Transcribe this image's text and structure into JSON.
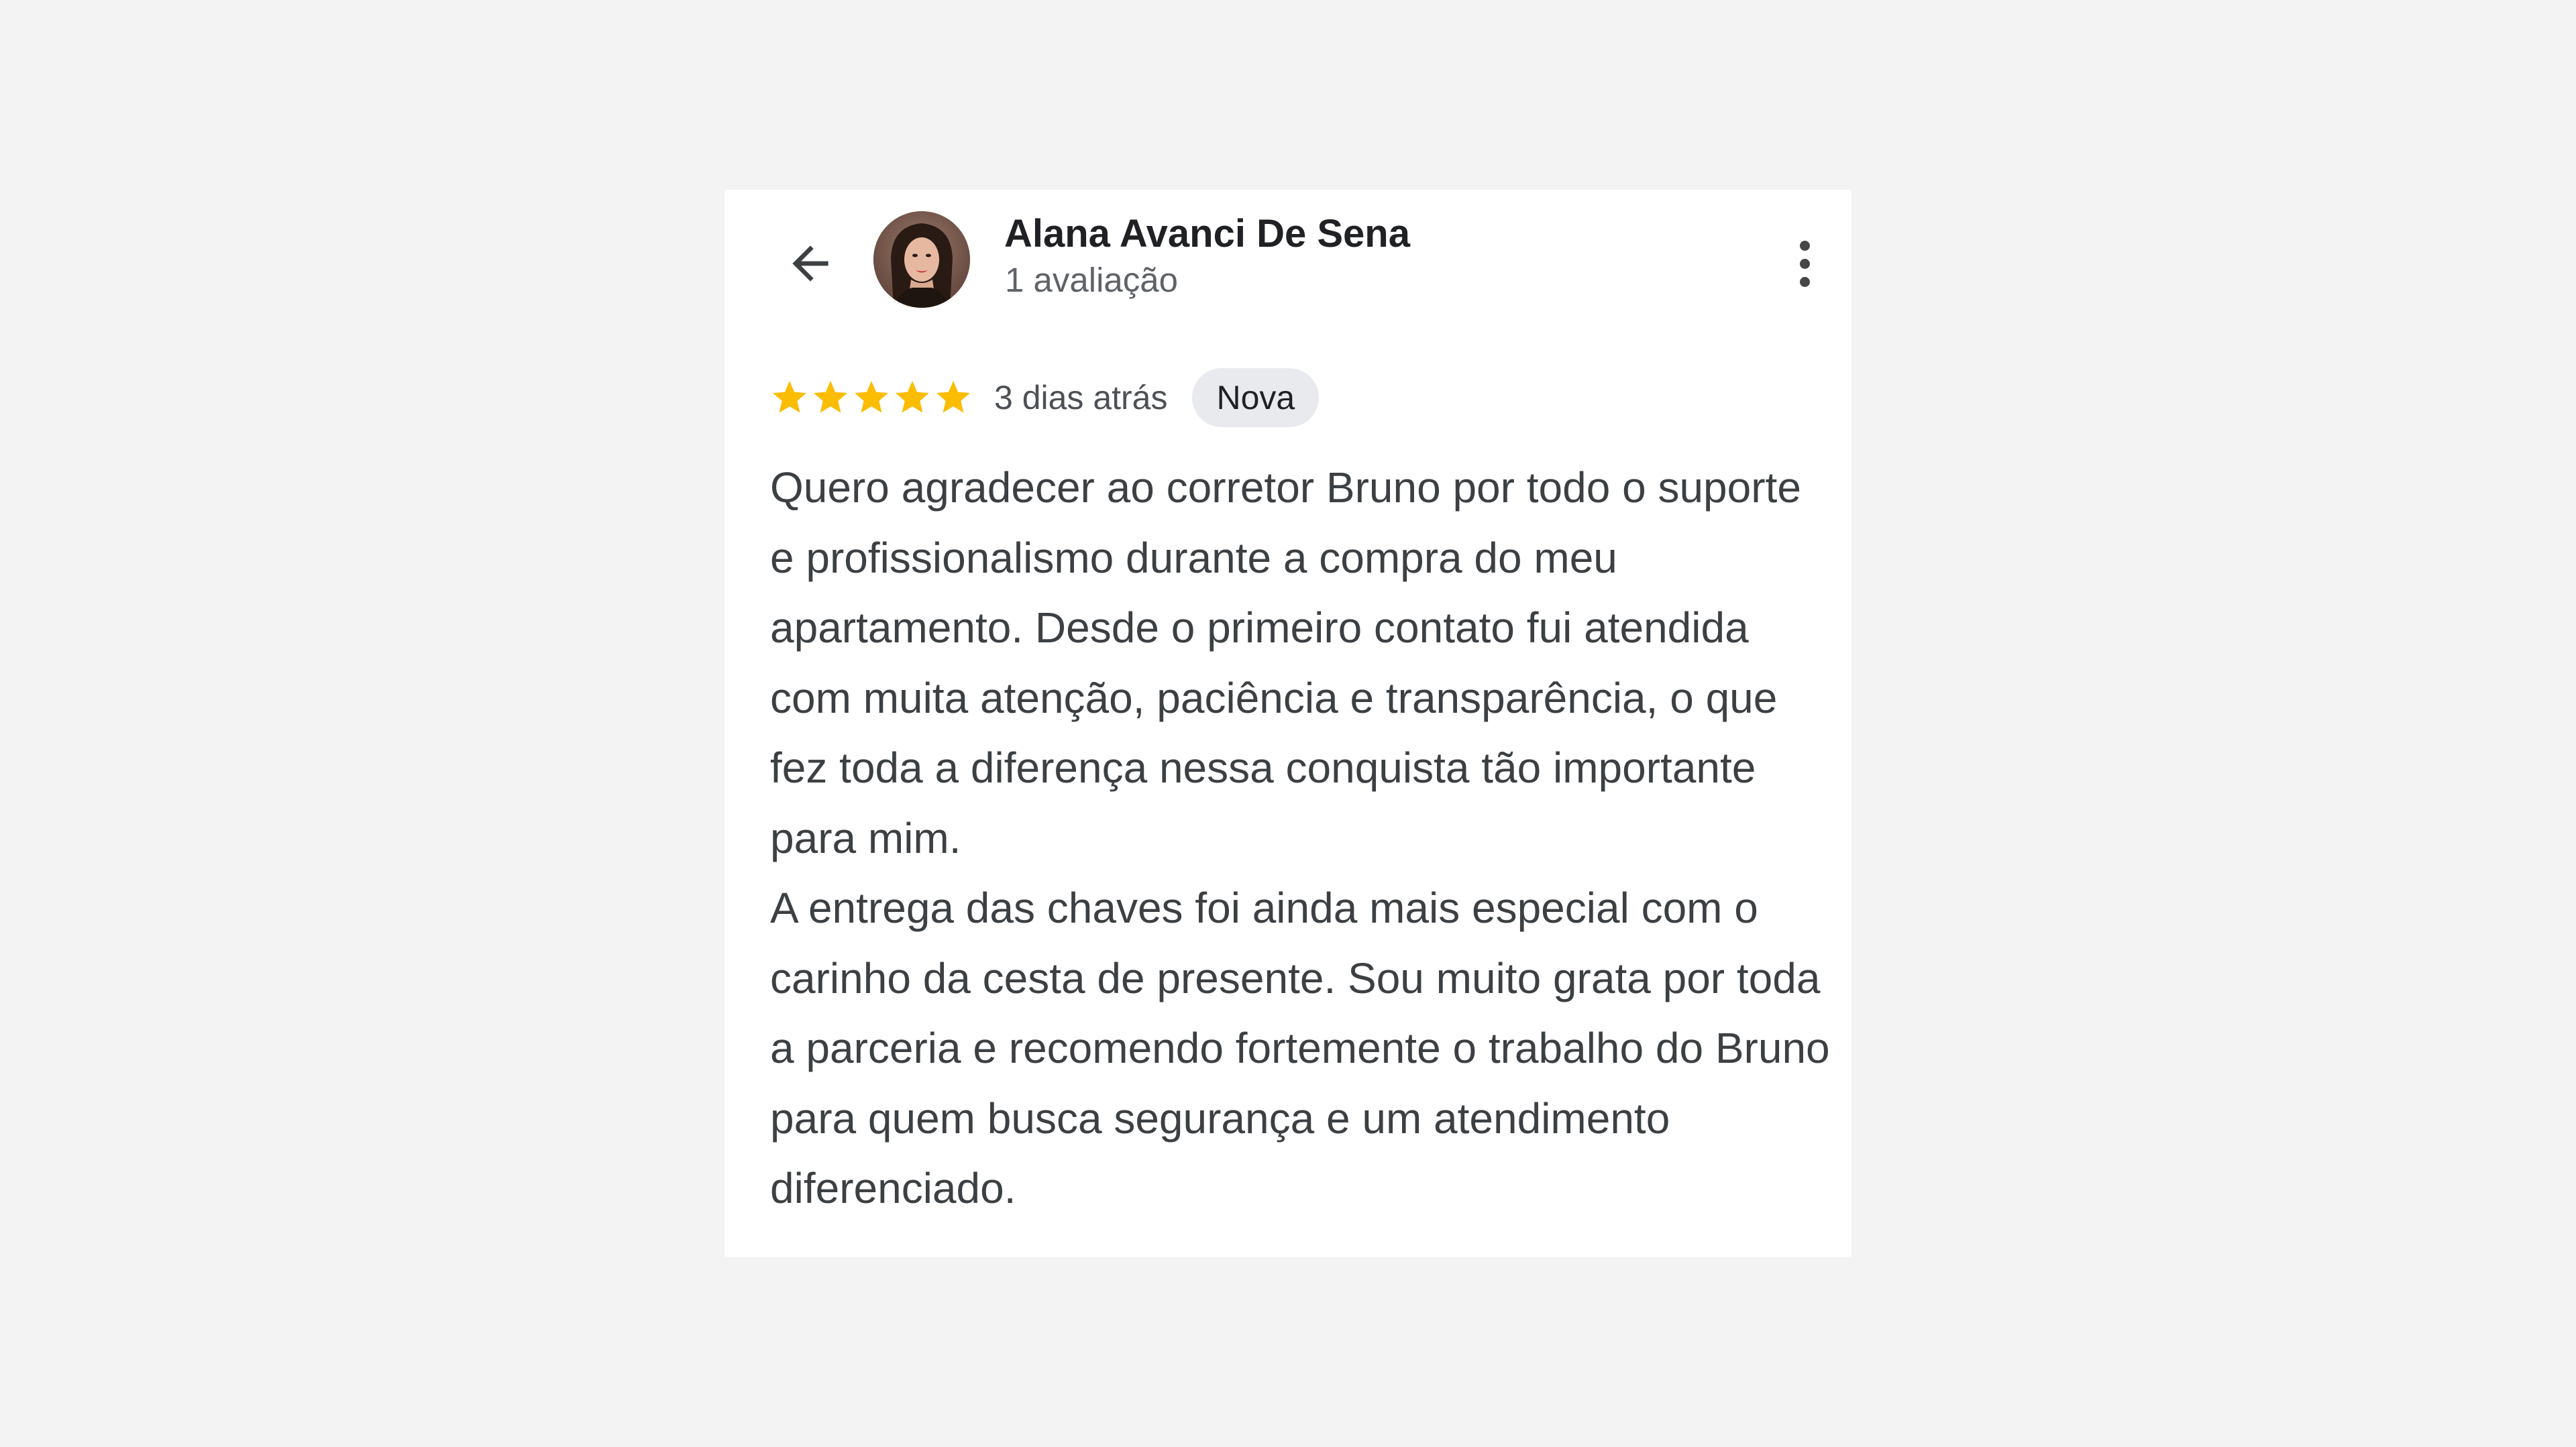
{
  "review": {
    "author_name": "Alana Avanci De Sena",
    "author_review_count": "1 avaliação",
    "rating": 5,
    "rating_max": 5,
    "date": "3 dias atrás",
    "badge": "Nova",
    "paragraphs": [
      "Quero agradecer ao corretor Bruno por todo o suporte e profissionalismo durante a compra do meu apartamento. Desde o primeiro contato fui atendida com muita atenção, paciência e transparência, o que fez toda a diferença nessa conquista tão importante para mim.",
      "A entrega das chaves foi ainda mais especial com o carinho da cesta de presente. Sou muito grata por toda a parceria e recomendo fortemente o trabalho do Bruno para quem busca segurança e um atendimento diferenciado."
    ]
  },
  "icons": {
    "back": "arrow-back-icon",
    "more": "more-vert-icon",
    "star": "star-icon"
  },
  "colors": {
    "star": "#fbbc04",
    "badge_bg": "#e8eaed",
    "page_bg": "#f3f3f3",
    "card_bg": "#ffffff"
  }
}
